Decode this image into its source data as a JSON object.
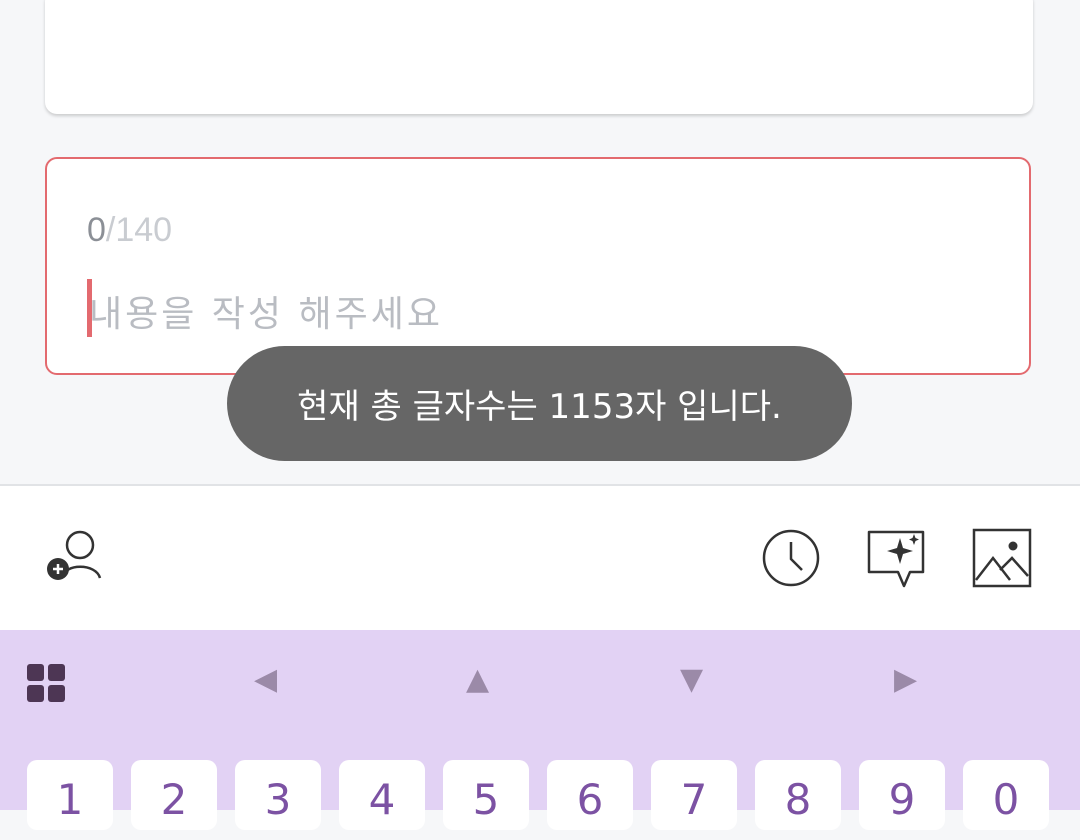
{
  "editor": {
    "count": "0",
    "max": "/140",
    "placeholder": "내용을 작성 해주세요"
  },
  "toast": {
    "message": "현재 총 글자수는 1153자 입니다."
  },
  "toolbar": {
    "icons": [
      "add-person-icon",
      "clock-icon",
      "ai-sparkle-chat-icon",
      "image-icon"
    ]
  },
  "keyboard": {
    "menu_icon": "grid-icon",
    "arrows": [
      "◀",
      "▲",
      "▼",
      "▶"
    ],
    "keys": [
      "1",
      "2",
      "3",
      "4",
      "5",
      "6",
      "7",
      "8",
      "9",
      "0"
    ],
    "colors": {
      "background": "#e2d2f4",
      "accent": "#7c52a3"
    }
  }
}
